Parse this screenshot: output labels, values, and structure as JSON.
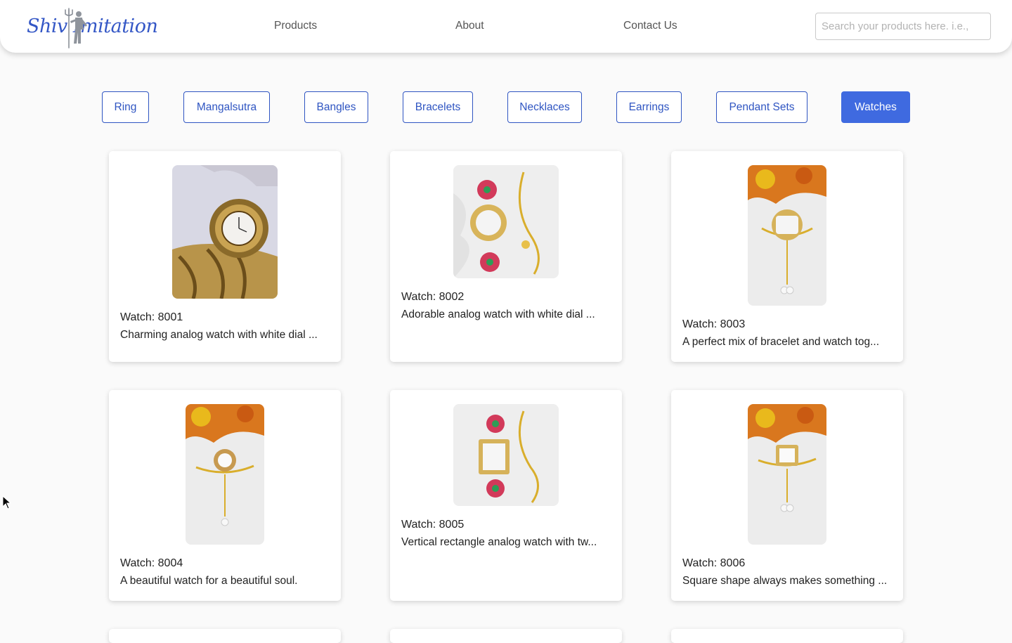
{
  "brand": {
    "logo_text": "Shiv Imitation",
    "color": "#3457c6"
  },
  "nav": {
    "links": [
      "Products",
      "About",
      "Contact Us"
    ]
  },
  "search": {
    "placeholder": "Search your products here. i.e., ",
    "value": ""
  },
  "categories": {
    "items": [
      "Ring",
      "Mangalsutra",
      "Bangles",
      "Bracelets",
      "Necklaces",
      "Earrings",
      "Pendant Sets",
      "Watches"
    ],
    "active": "Watches",
    "accent": "#3f6ae0"
  },
  "products": [
    {
      "title": "Watch: 8001",
      "desc": "Charming analog watch with white dial ..."
    },
    {
      "title": "Watch: 8002",
      "desc": "Adorable analog watch with white dial ..."
    },
    {
      "title": "Watch: 8003",
      "desc": "A perfect mix of bracelet and watch tog..."
    },
    {
      "title": "Watch: 8004",
      "desc": "A beautiful watch for a beautiful soul."
    },
    {
      "title": "Watch: 8005",
      "desc": "Vertical rectangle analog watch with tw..."
    },
    {
      "title": "Watch: 8006",
      "desc": "Square shape always makes something ..."
    }
  ]
}
